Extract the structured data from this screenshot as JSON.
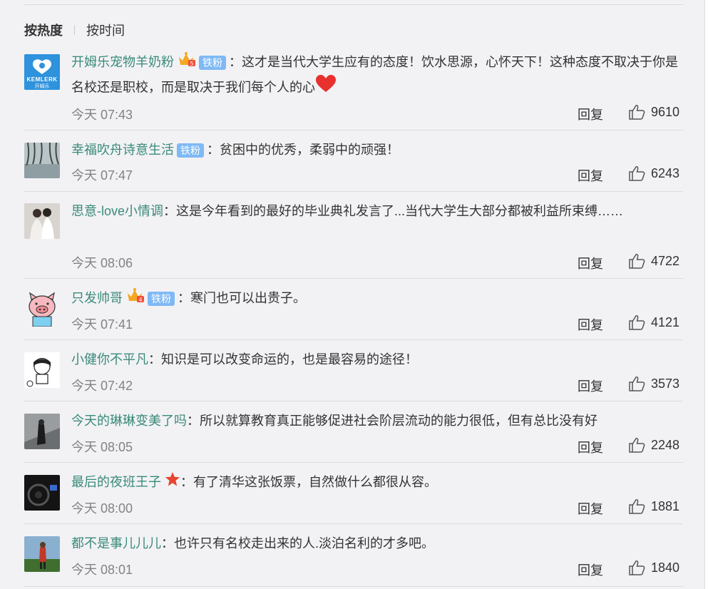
{
  "sort": {
    "hot": "按热度",
    "time": "按时间"
  },
  "reply_label": "回复",
  "colors": {
    "username": "#3a8a7a",
    "tiefan_badge": "#7fb9f5",
    "meta": "#828287"
  },
  "comments": [
    {
      "user": "开姆乐宠物羊奶粉",
      "badge": "铁粉",
      "text": "：这才是当代大学生应有的态度！饮水思源，心怀天下！这种态度不取决于你是名校还是职校，而是取决于我们每个人的心",
      "time": "今天 07:43",
      "likes": "9610",
      "avatar_text": "KEMLERK",
      "avatar_sub": "开姆乐"
    },
    {
      "user": "幸福吹舟诗意生活",
      "badge": "铁粉",
      "text": "：贫困中的优秀，柔弱中的顽强！",
      "time": "今天 07:47",
      "likes": "6243"
    },
    {
      "user": "思意-love小情调",
      "text": "：这是今年看到的最好的毕业典礼发言了...当代大学生大部分都被利益所束缚……",
      "time": "今天 08:06",
      "likes": "4722"
    },
    {
      "user": "只发帅哥",
      "badge": "铁粉",
      "text": "：寒门也可以出贵子。",
      "time": "今天 07:41",
      "likes": "4121"
    },
    {
      "user": "小健你不平凡",
      "text": "：知识是可以改变命运的，也是最容易的途径！",
      "time": "今天 07:42",
      "likes": "3573"
    },
    {
      "user": "今天的琳琳变美了吗",
      "text": "：所以就算教育真正能够促进社会阶层流动的能力很低，但有总比没有好",
      "time": "今天 08:05",
      "likes": "2248"
    },
    {
      "user": "最后的夜班王子",
      "text": "：有了清华这张饭票，自然做什么都很从容。",
      "time": "今天 08:00",
      "likes": "1881"
    },
    {
      "user": "都不是事儿儿儿",
      "text": "：也许只有名校走出来的人.淡泊名利的才多吧。",
      "time": "今天 08:01",
      "likes": "1840"
    }
  ]
}
